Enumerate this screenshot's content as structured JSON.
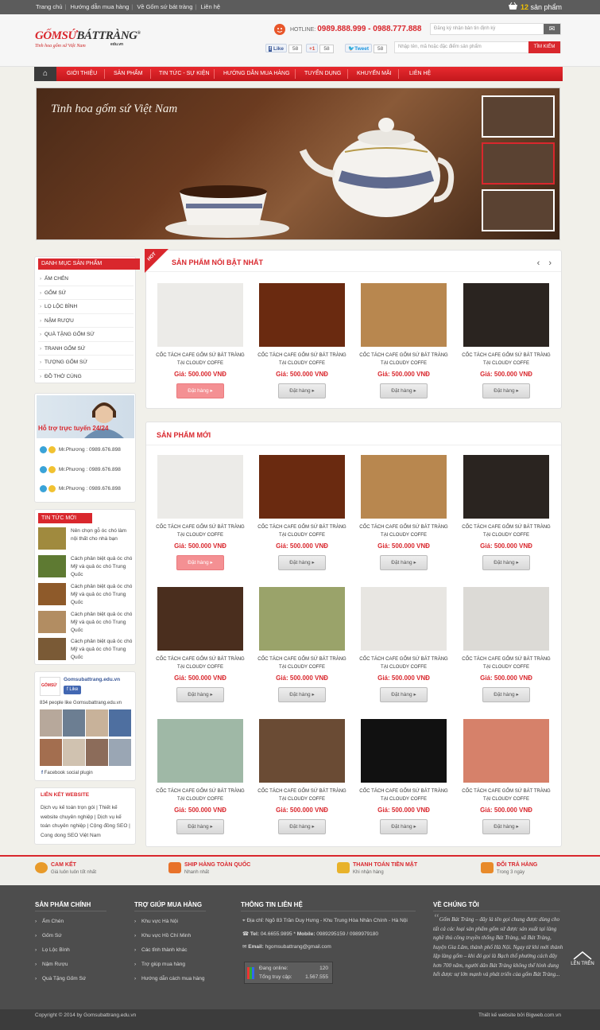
{
  "topbar": {
    "links": [
      "Trang chủ",
      "Hướng dẫn mua hàng",
      "Về Gốm sứ bát tràng",
      "Liên hệ"
    ],
    "cart_count": "12",
    "cart_label": "sản phẩm"
  },
  "header": {
    "logo_text_red": "GỐMSỨ",
    "logo_text_dark": "BÁTTRÀNG",
    "logo_domain": "edu.vn",
    "logo_tagline": "Tinh hoa gốm sứ Việt Nam",
    "hotline_label": "HOTLINE:",
    "hotline_numbers": "0989.888.999 - 0988.777.888",
    "subscribe_placeholder": "Đăng ký nhận bản tin định kỳ",
    "search_placeholder": "Nhập tên, mã hoặc đặc điểm sản phẩm",
    "search_button": "TÌM KIẾM",
    "social": {
      "fb_like": "Like",
      "fb_count": "58",
      "gplus": "+1",
      "gplus_count": "58",
      "tweet": "Tweet",
      "tweet_count": "58"
    }
  },
  "nav": {
    "items": [
      "GIỚI THIỆU",
      "SẢN PHẨM",
      "TIN TỨC - SỰ KIỆN",
      "HƯỚNG DẪN MUA HÀNG",
      "TUYỂN DỤNG",
      "KHUYẾN MÃI",
      "LIÊN HỆ"
    ]
  },
  "slider": {
    "caption": "Tinh hoa gốm sứ Việt Nam"
  },
  "sidebar": {
    "category_title": "DANH MỤC SẢN PHẨM",
    "categories": [
      "ẤM CHÉN",
      "GỐM SỨ",
      "LỌ LỘC BÌNH",
      "NẬM RƯỢU",
      "QUÀ TẶNG GỐM SỨ",
      "TRANH GỐM SỨ",
      "TƯỢNG GỐM SỨ",
      "ĐỒ THỜ CÚNG"
    ],
    "support_label": "Hỗ trợ trực tuyến 24/24",
    "support": [
      "Mr.Phương : 0989.676.898",
      "Mr.Phương : 0989.676.898",
      "Mr.Phương : 0989.676.898"
    ],
    "news_title": "TIN TỨC MỚI NHẤT",
    "news": [
      "Nên chọn gỗ óc chó làm nội thất cho nhà bạn",
      "Cách phân biệt quả óc chó Mỹ và quả óc chó Trung Quốc",
      "Cách phân biệt quả óc chó Mỹ và quả óc chó Trung Quốc",
      "Cách phân biệt quả óc chó Mỹ và quả óc chó Trung Quốc",
      "Cách phân biệt quả óc chó Mỹ và quả óc chó Trung Quốc"
    ],
    "fb_name": "Gomsubattrang.edu.vn",
    "fb_like": "Like",
    "fb_count": "834 people like Gomsubattrang.edu.vn",
    "fb_plugin": "Facebook social plugin",
    "links_title": "LIÊN KẾT WEBSITE",
    "links_text": "Dịch vụ kế toán trọn gói | Thiết kế website chuyên nghiệp | Dịch vụ kế toán chuyên nghiệp | Cộng đồng SEO | Cong dong SEO Việt Nam"
  },
  "featured": {
    "hot_badge": "HOT",
    "title": "SẢN PHẨM NỔI BẬT NHẤT",
    "arrows": "‹ ›"
  },
  "new_products": {
    "title": "SẢN PHẨM MỚI"
  },
  "product": {
    "name": "CỐC TÁCH CAFE GỐM SỨ BÁT TRÀNG TẠI CLOUDY COFFE",
    "price": "Giá: 500.000 VNĐ",
    "buy": "Đặt hàng"
  },
  "badges": [
    {
      "title": "CAM KẾT",
      "sub": "Giá luôn luôn tốt nhất"
    },
    {
      "title": "SHIP HÀNG TOÀN QUỐC",
      "sub": "Nhanh nhất"
    },
    {
      "title": "THANH TOÁN TIỀN MẶT",
      "sub": "Khi nhận hàng"
    },
    {
      "title": "ĐỔI TRẢ HÀNG",
      "sub": "Trong 3 ngày"
    }
  ],
  "footer": {
    "col1_title": "SẢN PHẨM CHÍNH",
    "col1": [
      "Ấm Chén",
      "Gốm Sứ",
      "Lọ Lộc Bình",
      "Nậm Rượu",
      "Quà Tặng Gốm Sứ"
    ],
    "col2_title": "TRỢ GIÚP MUA HÀNG",
    "col2": [
      "Khu vực Hà Nội",
      "Khu vực Hồ Chí Minh",
      "Các tỉnh thành khác",
      "Trợ giúp mua hàng",
      "Hướng dẫn cách mua hàng"
    ],
    "col3_title": "THÔNG TIN LIÊN HỆ",
    "address_label": "Địa chỉ:",
    "address": "Ngõ 83 Trần Duy Hưng - Khu Trung Hòa Nhân Chính - Hà Nội",
    "tel_label": "Tel:",
    "tel": "04.6655.9895 *",
    "mobile_label": "Mobile:",
    "mobile": "0989295159 / 0989979180",
    "email_label": "Email:",
    "email": "hgomsubattrang@gmail.com",
    "online_label": "Đang online:",
    "online": "120",
    "total_label": "Tổng truy cập:",
    "total": "1.567.555",
    "col4_title": "VỀ CHÚNG TÔI",
    "about": "Gốm Bát Tràng – đây là tên gọi chung được dùng cho tất cả các loại sản phẩm gốm sứ được sản xuất tại làng nghề thủ công truyền thống Bát Tràng, xã Bát Tràng, huyện Gia Lâm, thành phố Hà Nội. Ngay từ khi mới thành lập làng gốm – khi đó gọi là Bạch thổ phường cách đây hơn 700 năm, người dân Bát Tràng không thể hình dung hết được sự lớn mạnh và phát triển của gốm Bát Tràng...",
    "to_top": "LÊN TRÊN",
    "copyright": "Copyright © 2014 by Gomsubattrang.edu.vn",
    "credit": "Thiết kế website bởi Bigweb.com.vn"
  }
}
